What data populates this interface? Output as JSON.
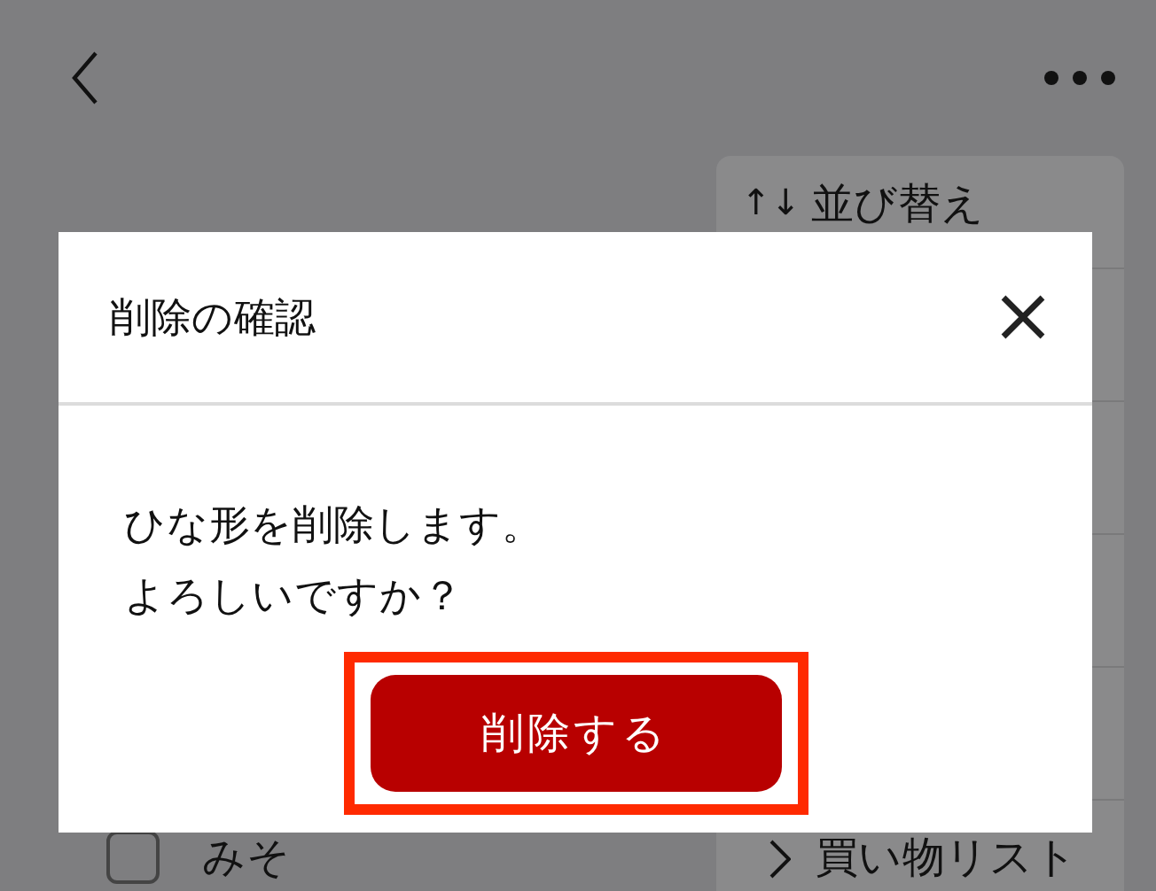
{
  "menu": {
    "items": [
      {
        "kind": "sort",
        "glyph": "↑↓",
        "label": "並び替え"
      },
      {
        "kind": "blank"
      },
      {
        "kind": "blank"
      },
      {
        "kind": "blank"
      },
      {
        "kind": "blank"
      },
      {
        "kind": "link",
        "label": "買い物リスト"
      }
    ]
  },
  "list": {
    "items": [
      {
        "label": "みそ",
        "checked": false
      }
    ]
  },
  "dialog": {
    "title": "削除の確認",
    "message": [
      "ひな形を削除します。",
      "よろしいですか？"
    ],
    "button": "削除する",
    "highlighted": true
  }
}
